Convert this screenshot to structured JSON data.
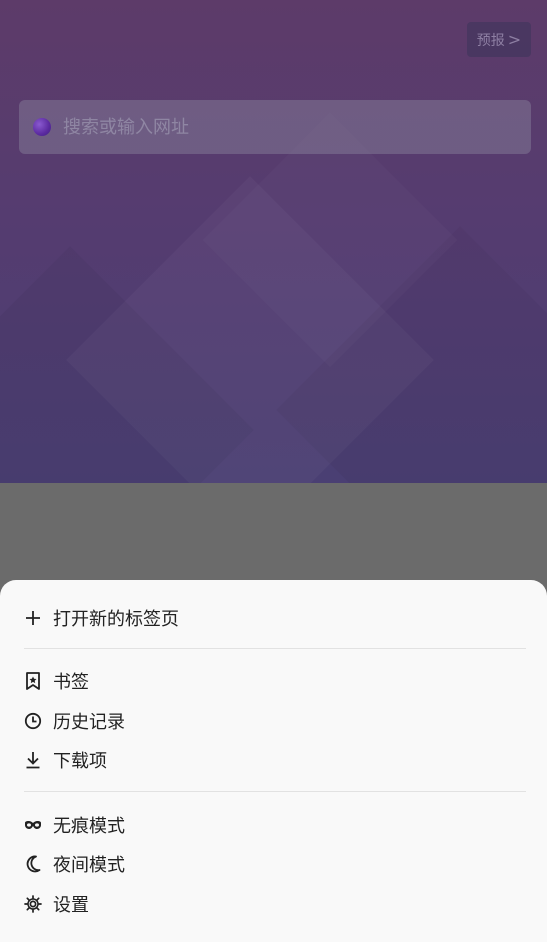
{
  "header": {
    "forecast_label": "预报",
    "forecast_chevron": ">"
  },
  "search": {
    "placeholder": "搜索或输入网址",
    "engine_icon": "search-engine-icon"
  },
  "menu": {
    "new_tab": {
      "label": "打开新的标签页",
      "icon": "plus-icon"
    },
    "bookmarks": {
      "label": "书签",
      "icon": "bookmark-icon"
    },
    "history": {
      "label": "历史记录",
      "icon": "clock-icon"
    },
    "downloads": {
      "label": "下载项",
      "icon": "download-icon"
    },
    "incognito": {
      "label": "无痕模式",
      "icon": "incognito-icon"
    },
    "night_mode": {
      "label": "夜间模式",
      "icon": "moon-icon"
    },
    "settings": {
      "label": "设置",
      "icon": "gear-icon"
    }
  },
  "colors": {
    "hero_top": "#5d3b69",
    "hero_bottom": "#4a3f73",
    "sheet_background": "#f9f9f9",
    "scrim": "#6b6b6b"
  }
}
